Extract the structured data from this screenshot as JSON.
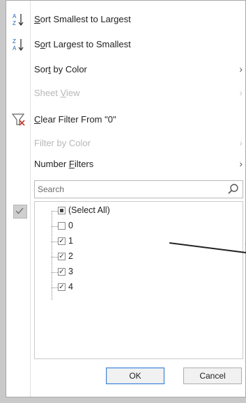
{
  "menu": {
    "sort_asc": {
      "label": "Sort Smallest to Largest",
      "mn": "S",
      "rest": "ort Smallest to Largest"
    },
    "sort_desc": {
      "pre": "S",
      "mn": "o",
      "rest": "rt Largest to Smallest"
    },
    "sort_color": {
      "pre": "Sor",
      "mn": "t",
      "rest": " by Color"
    },
    "sheet_view": {
      "pre": "Sheet ",
      "mn": "V",
      "rest": "iew"
    },
    "clear_filter": {
      "pre": "",
      "mn": "C",
      "rest": "lear Filter From \"0\""
    },
    "filter_color": {
      "label": "Filter by Color"
    },
    "number_filters": {
      "pre": "Number ",
      "mn": "F",
      "rest": "ilters"
    },
    "arrow": "›"
  },
  "search": {
    "placeholder": "Search"
  },
  "list": {
    "items": [
      {
        "label": "(Select All)",
        "state": "partial"
      },
      {
        "label": "0",
        "state": "unchecked"
      },
      {
        "label": "1",
        "state": "checked"
      },
      {
        "label": "2",
        "state": "checked"
      },
      {
        "label": "3",
        "state": "checked"
      },
      {
        "label": "4",
        "state": "checked"
      }
    ]
  },
  "buttons": {
    "ok": "OK",
    "cancel": "Cancel"
  },
  "colors": {
    "accent": "#3c7fd0",
    "filter_icon": "#c0392b"
  },
  "icons": {
    "sort_asc": "sort-ascending-icon",
    "sort_desc": "sort-descending-icon",
    "clear_filter": "clear-filter-icon",
    "search": "search-icon"
  }
}
